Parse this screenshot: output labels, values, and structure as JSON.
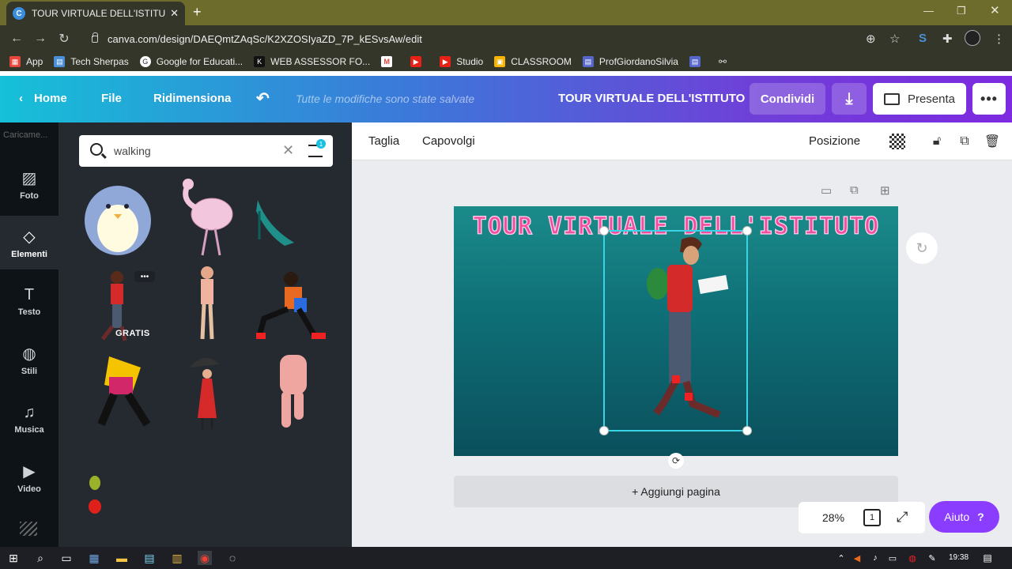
{
  "browser": {
    "tab_title": "TOUR VIRTUALE DELL'ISTITUTO -",
    "tab_favicon_letter": "C",
    "url": "canva.com/design/DAEQmtZAqSc/K2XZOSIyaZD_7P_kESvsAw/edit",
    "bookmarks": [
      {
        "label": "App",
        "icon": "apps-grid-icon",
        "color": "#e8453c"
      },
      {
        "label": "Tech Sherpas",
        "icon": "doc-icon",
        "color": "#4a90d9"
      },
      {
        "label": "Google for Educati...",
        "icon": "google-icon",
        "color": "#ffffff"
      },
      {
        "label": "WEB ASSESSOR FO...",
        "icon": "k-icon",
        "color": "#222222"
      },
      {
        "label": "",
        "icon": "gmail-icon",
        "color": "#d44638"
      },
      {
        "label": "",
        "icon": "youtube-icon",
        "color": "#e62117"
      },
      {
        "label": "Studio",
        "icon": "youtube-icon",
        "color": "#e62117"
      },
      {
        "label": "CLASSROOM",
        "icon": "classroom-icon",
        "color": "#f4b400"
      },
      {
        "label": "ProfGiordanoSilvia",
        "icon": "site-icon",
        "color": "#5566cc"
      },
      {
        "label": "",
        "icon": "site-icon",
        "color": "#5566cc"
      },
      {
        "label": "",
        "icon": "link-icon",
        "color": "#dddddd"
      }
    ]
  },
  "canva": {
    "home": "Home",
    "file": "File",
    "resize": "Ridimensiona",
    "saved_status": "Tutte le modifiche sono state salvate",
    "design_title": "TOUR VIRTUALE DELL'ISTITUTO",
    "share": "Condividi",
    "present": "Presenta",
    "sidebar": {
      "loading": "Caricame...",
      "items": [
        {
          "label": "Foto",
          "icon": "photo-icon"
        },
        {
          "label": "Elementi",
          "icon": "shapes-icon"
        },
        {
          "label": "Testo",
          "icon": "text-icon"
        },
        {
          "label": "Stili",
          "icon": "palette-icon"
        },
        {
          "label": "Musica",
          "icon": "music-icon"
        },
        {
          "label": "Video",
          "icon": "video-icon"
        }
      ]
    },
    "search": {
      "query": "walking",
      "filter_count": "1"
    },
    "elements": {
      "free_badge": "GRATIS"
    },
    "toolbar": {
      "crop": "Taglia",
      "flip": "Capovolgi",
      "position": "Posizione"
    },
    "page": {
      "title_text": "TOUR VIRTUALE DELL'ISTITUTO"
    },
    "add_page": "+ Aggiungi pagina",
    "zoom": "28%",
    "page_count": "1",
    "help": "Aiuto",
    "colors": {
      "accent": "#8b3dff",
      "selection": "#3ad4e6",
      "title_pink": "#f04ea0"
    }
  },
  "taskbar": {
    "time": "19:38"
  }
}
